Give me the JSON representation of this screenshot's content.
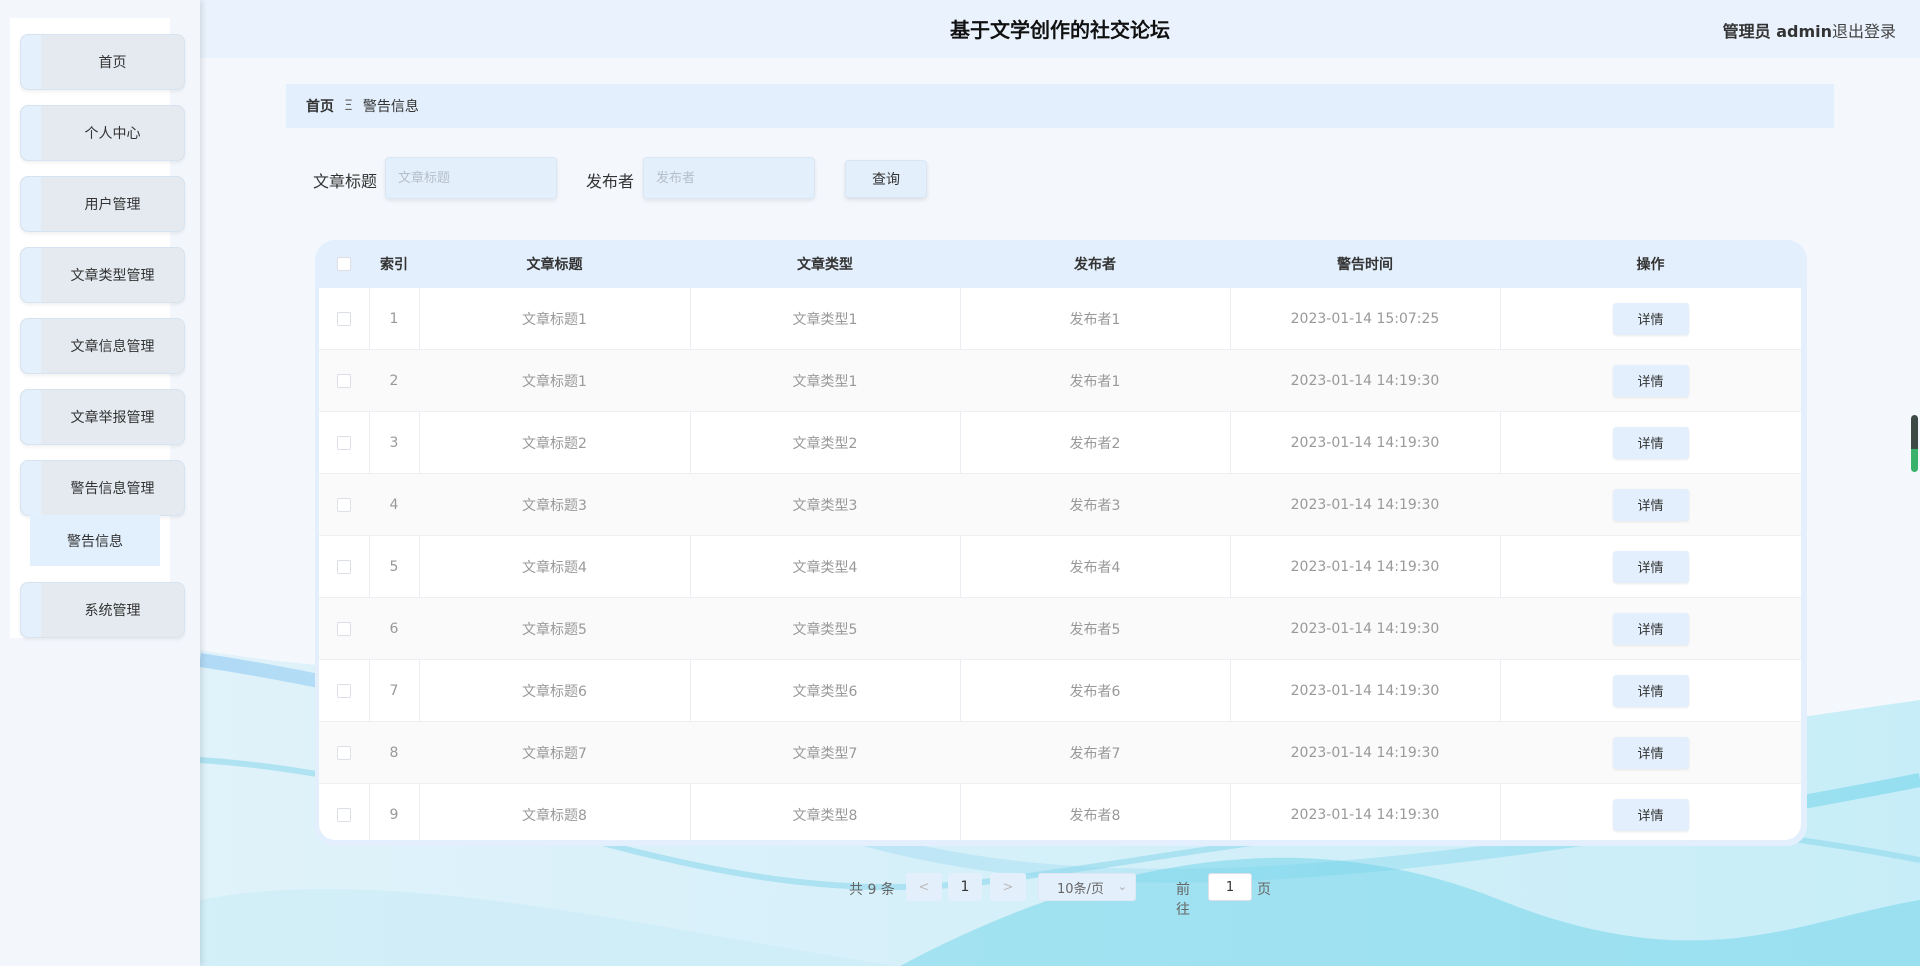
{
  "header": {
    "title": "基于文学创作的社交论坛",
    "user": "管理员 admin",
    "logout": "退出登录"
  },
  "sidebar": {
    "items": [
      {
        "label": "首页",
        "icon": "home-icon"
      },
      {
        "label": "个人中心",
        "icon": "user-icon"
      },
      {
        "label": "用户管理",
        "icon": "users-icon"
      },
      {
        "label": "文章类型管理",
        "icon": "category-icon"
      },
      {
        "label": "文章信息管理",
        "icon": "article-icon"
      },
      {
        "label": "文章举报管理",
        "icon": "report-icon"
      },
      {
        "label": "警告信息管理",
        "icon": "warning-icon"
      },
      {
        "label": "系统管理",
        "icon": "settings-icon"
      }
    ],
    "submenu": {
      "label": "警告信息"
    }
  },
  "breadcrumb": {
    "home": "首页",
    "separator": "Ξ",
    "current": "警告信息"
  },
  "search": {
    "title_label": "文章标题",
    "title_placeholder": "文章标题",
    "publisher_label": "发布者",
    "publisher_placeholder": "发布者",
    "query_button": "查询"
  },
  "table": {
    "columns": [
      "索引",
      "文章标题",
      "文章类型",
      "发布者",
      "警告时间",
      "操作"
    ],
    "action_label": "详情",
    "rows": [
      {
        "index": "1",
        "title": "文章标题1",
        "type": "文章类型1",
        "publisher": "发布者1",
        "time": "2023-01-14 15:07:25"
      },
      {
        "index": "2",
        "title": "文章标题1",
        "type": "文章类型1",
        "publisher": "发布者1",
        "time": "2023-01-14 14:19:30"
      },
      {
        "index": "3",
        "title": "文章标题2",
        "type": "文章类型2",
        "publisher": "发布者2",
        "time": "2023-01-14 14:19:30"
      },
      {
        "index": "4",
        "title": "文章标题3",
        "type": "文章类型3",
        "publisher": "发布者3",
        "time": "2023-01-14 14:19:30"
      },
      {
        "index": "5",
        "title": "文章标题4",
        "type": "文章类型4",
        "publisher": "发布者4",
        "time": "2023-01-14 14:19:30"
      },
      {
        "index": "6",
        "title": "文章标题5",
        "type": "文章类型5",
        "publisher": "发布者5",
        "time": "2023-01-14 14:19:30"
      },
      {
        "index": "7",
        "title": "文章标题6",
        "type": "文章类型6",
        "publisher": "发布者6",
        "time": "2023-01-14 14:19:30"
      },
      {
        "index": "8",
        "title": "文章标题7",
        "type": "文章类型7",
        "publisher": "发布者7",
        "time": "2023-01-14 14:19:30"
      },
      {
        "index": "9",
        "title": "文章标题8",
        "type": "文章类型8",
        "publisher": "发布者8",
        "time": "2023-01-14 14:19:30"
      }
    ]
  },
  "pagination": {
    "total": "共 9 条",
    "prev": "<",
    "current_page": "1",
    "next": ">",
    "page_size": "10条/页",
    "goto_label": "前往",
    "goto_value": "1",
    "page_unit": "页"
  },
  "colors": {
    "accent": "#e3effc",
    "header_bg": "#eaf3fd",
    "wave": "#5bc8e6"
  }
}
